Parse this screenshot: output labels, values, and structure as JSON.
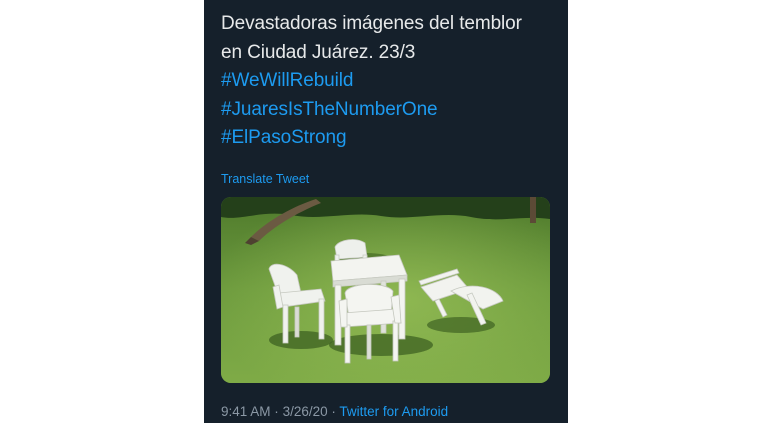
{
  "tweet": {
    "text_lines": [
      "Devastadoras imágenes del temblor",
      "en Ciudad Juárez. 23/3"
    ],
    "hashtags": [
      "#WeWillRebuild",
      "#JuaresIsTheNumberOne",
      "#ElPasoStrong"
    ],
    "translate_label": "Translate Tweet",
    "time": "9:41 AM",
    "separator": "·",
    "date": "3/26/20",
    "source": "Twitter for Android"
  },
  "colors": {
    "card_background": "#15202b",
    "text": "#e7e9ea",
    "link": "#1d9bf0",
    "meta": "#8b98a5"
  }
}
